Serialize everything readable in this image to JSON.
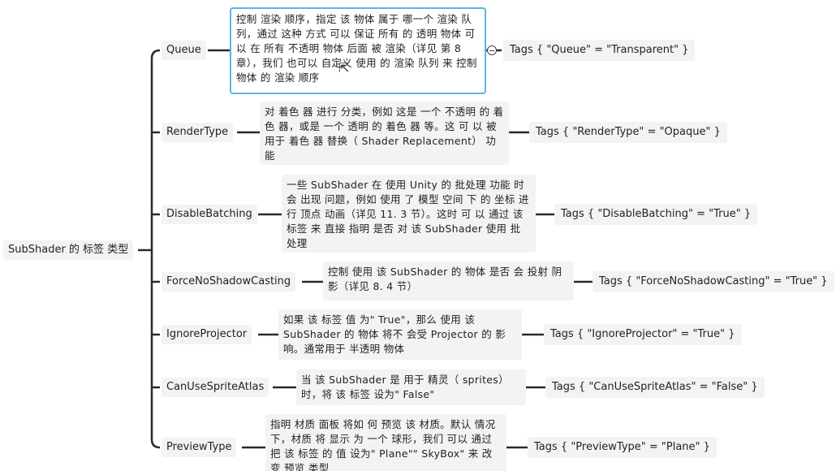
{
  "root": {
    "label": "SubShader 的 标签 类型"
  },
  "branches": [
    {
      "label": "Queue",
      "desc": "控制 渲染 顺序，指定 该 物体 属于 哪一个 渲染 队列，通过 这种 方式 可以 保证 所有 的 透明 物体 可以 在 所有 不透明 物体 后面 被 渲染（详见 第 8 章），我们 也可以 自定义 使用 的 渲染 队列 来 控制 物体 的 渲染 顺序",
      "tag": "Tags { \"Queue\" = \"Transparent\" }"
    },
    {
      "label": "RenderType",
      "desc": "对 着色 器 进行 分类，例如 这是 一个 不透明 的 着色 器，或是 一个 透明 的 着色 器 等。这 可 以 被 用于 着色 器 替换（ Shader Replacement） 功能",
      "tag": "Tags { \"RenderType\" = \"Opaque\" }"
    },
    {
      "label": "DisableBatching",
      "desc": "一些 SubShader 在 使用 Unity 的 批处理 功能 时会 出现 问题，例如 使用 了 模型 空间 下 的 坐标 进行 顶点 动画（详见 11. 3 节）。这时 可 以 通过 该 标签 来 直接 指明 是否 对 该 SubShader 使用 批处理",
      "tag": "Tags { \"DisableBatching\" = \"True\" }"
    },
    {
      "label": "ForceNoShadowCasting",
      "desc": "控制 使用 该 SubShader 的 物体 是否 会 投射 阴影（详见 8. 4 节）",
      "tag": "Tags { \"ForceNoShadowCasting\" = \"True\" }"
    },
    {
      "label": "IgnoreProjector",
      "desc": "如果 该 标签 值 为\" True\"，那么 使用 该 SubShader 的 物体 将不 会受 Projector 的 影响。通常用于 半透明 物体",
      "tag": "Tags { \"IgnoreProjector\" = \"True\" }"
    },
    {
      "label": "CanUseSpriteAtlas",
      "desc": "当 该 SubShader 是 用于 精灵（ sprites） 时，将 该 标签 设为\" False\"",
      "tag": "Tags { \"CanUseSpriteAtlas\" = \"False\" }"
    },
    {
      "label": "PreviewType",
      "desc": "指明 材质 面板 将如 何 预览 该 材质。默认 情况下，材质 将 显示 为 一个 球形，我们 可以 通过 把 该 标签 的 值 设为\" Plane\"\" SkyBox\" 来 改变 预览 类型",
      "tag": "Tags { \"PreviewType\" = \"Plane\" }"
    }
  ]
}
